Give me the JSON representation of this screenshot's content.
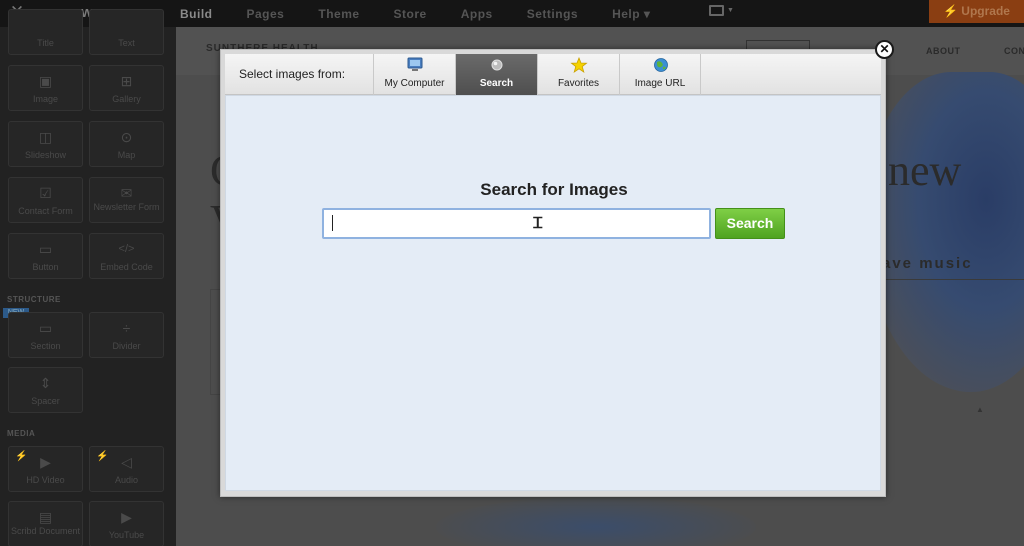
{
  "topbar": {
    "close_glyph": "✕",
    "logo_glyph": "w",
    "nav": [
      "Build",
      "Pages",
      "Theme",
      "Store",
      "Apps",
      "Settings",
      "Help ▾"
    ],
    "active_nav": "Build",
    "upgrade_label": "⚡ Upgrade",
    "upgrade_color": "#8a3e12"
  },
  "sidebar": {
    "tiles": [
      {
        "label": "Title",
        "icon": "title-icon",
        "glyph": "T"
      },
      {
        "label": "Text",
        "icon": "text-icon",
        "glyph": "≡"
      },
      {
        "label": "Image",
        "icon": "image-icon",
        "glyph": "▣"
      },
      {
        "label": "Gallery",
        "icon": "gallery-icon",
        "glyph": "⊞"
      },
      {
        "label": "Slideshow",
        "icon": "slideshow-icon",
        "glyph": "◫"
      },
      {
        "label": "Map",
        "icon": "map-pin-icon",
        "glyph": "⊙"
      },
      {
        "label": "Contact Form",
        "icon": "contact-form-icon",
        "glyph": "☑"
      },
      {
        "label": "Newsletter Form",
        "icon": "envelope-icon",
        "glyph": "✉"
      },
      {
        "label": "Button",
        "icon": "button-icon",
        "glyph": "▭"
      },
      {
        "label": "Embed Code",
        "icon": "code-icon",
        "glyph": "</>"
      },
      {
        "label": "Section",
        "icon": "section-icon",
        "glyph": "▭"
      },
      {
        "label": "Divider",
        "icon": "divider-icon",
        "glyph": "÷"
      },
      {
        "label": "Spacer",
        "icon": "spacer-icon",
        "glyph": "⇕"
      },
      {
        "label": "HD Video",
        "icon": "video-icon",
        "glyph": "▶"
      },
      {
        "label": "Audio",
        "icon": "audio-icon",
        "glyph": "◁"
      },
      {
        "label": "Scribd Document",
        "icon": "document-icon",
        "glyph": "▤"
      },
      {
        "label": "YouTube",
        "icon": "youtube-icon",
        "glyph": "▶"
      }
    ],
    "structure_label": "STRUCTURE",
    "media_label": "MEDIA",
    "new_badge": "NEW"
  },
  "preview": {
    "site_title": "SUNTHERE HEALTH",
    "nav_about": "ABOUT",
    "nav_con": "CON",
    "hero_word": "new",
    "hero_sub": "ave music",
    "left_glyph_1": "C",
    "left_glyph_2": "V"
  },
  "modal": {
    "close_glyph": "✕",
    "select_label": "Select images from:",
    "tabs": [
      {
        "label": "My Computer",
        "icon": "computer-icon"
      },
      {
        "label": "Search",
        "icon": "search-sphere-icon"
      },
      {
        "label": "Favorites",
        "icon": "star-icon"
      },
      {
        "label": "Image URL",
        "icon": "globe-icon"
      }
    ],
    "active_tab": "Search",
    "search_title": "Search for Images",
    "search_value": "",
    "search_button": "Search",
    "content_bg": "#e4ecf6",
    "button_color": "#5fb42a"
  }
}
